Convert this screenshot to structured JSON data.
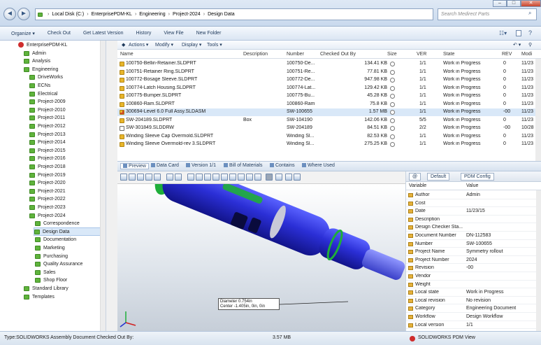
{
  "address": {
    "crumbs": [
      "Local Disk (C:)",
      "EnterprisePDM-KL",
      "Engineering",
      "Project-2024",
      "Design Data"
    ],
    "separator": "›",
    "search_placeholder": "Search Medirect Parts"
  },
  "window_buttons": {
    "minimize": "–",
    "maximize": "□",
    "close": "✕"
  },
  "toolbar": {
    "items": [
      "Organize ▾",
      "Check Out",
      "Get Latest Version",
      "History",
      "View File",
      "New Folder"
    ]
  },
  "tree": {
    "root": "EnterprisePDM-KL",
    "items": [
      {
        "label": "Admin"
      },
      {
        "label": "Analysis"
      },
      {
        "label": "Engineering"
      },
      {
        "label": "DriveWorks"
      },
      {
        "label": "ECNs"
      },
      {
        "label": "Electrical"
      },
      {
        "label": "Project-2009"
      },
      {
        "label": "Project-2010"
      },
      {
        "label": "Project-2011"
      },
      {
        "label": "Project-2012"
      },
      {
        "label": "Project-2013"
      },
      {
        "label": "Project-2014"
      },
      {
        "label": "Project-2015"
      },
      {
        "label": "Project-2016"
      },
      {
        "label": "Project-2018"
      },
      {
        "label": "Project-2019"
      },
      {
        "label": "Project-2020"
      },
      {
        "label": "Project-2021"
      },
      {
        "label": "Project-2022"
      },
      {
        "label": "Project-2023"
      },
      {
        "label": "Project-2024"
      },
      {
        "label": "Correspondence"
      },
      {
        "label": "Design Data"
      },
      {
        "label": "Documentation"
      },
      {
        "label": "Marketing"
      },
      {
        "label": "Purchasing"
      },
      {
        "label": "Quality Assurance"
      },
      {
        "label": "Sales"
      },
      {
        "label": "Shop Floor"
      },
      {
        "label": "Standard Library"
      },
      {
        "label": "Templates"
      }
    ]
  },
  "list_toolbar": [
    "Actions ▾",
    "Modify ▾",
    "Display ▾",
    "Tools ▾"
  ],
  "columns": [
    "Name",
    "Description",
    "Number",
    "Checked Out By",
    "Size",
    "VER",
    "State",
    "REV",
    "Modi"
  ],
  "files": [
    {
      "name": "100750-Bellin-Retainer.SLDPRT",
      "desc": "",
      "number": "100750-De...",
      "size": "134.41 KB",
      "ver": "1/1",
      "state": "Work in Progress",
      "rev": "0",
      "mod": "11/23"
    },
    {
      "name": "100751-Retainer Ring.SLDPRT",
      "desc": "",
      "number": "100751-Re...",
      "size": "77.81 KB",
      "ver": "1/1",
      "state": "Work in Progress",
      "rev": "0",
      "mod": "11/23"
    },
    {
      "name": "100772-Bosage Sleeve.SLDPRT",
      "desc": "",
      "number": "100772-De...",
      "size": "947.98 KB",
      "ver": "1/1",
      "state": "Work in Progress",
      "rev": "0",
      "mod": "11/23"
    },
    {
      "name": "100774-Latch Housing.SLDPRT",
      "desc": "",
      "number": "100774-Lat...",
      "size": "129.42 KB",
      "ver": "1/1",
      "state": "Work in Progress",
      "rev": "0",
      "mod": "11/23"
    },
    {
      "name": "100775-Bumper.SLDPRT",
      "desc": "",
      "number": "100775-Bu...",
      "size": "45.28 KB",
      "ver": "1/1",
      "state": "Work in Progress",
      "rev": "0",
      "mod": "11/23"
    },
    {
      "name": "100860-Ram.SLDPRT",
      "desc": "",
      "number": "100860-Ram",
      "size": "75.8 KB",
      "ver": "1/1",
      "state": "Work in Progress",
      "rev": "0",
      "mod": "11/23"
    },
    {
      "name": "300694-Level 6.0 Full Assy.SLDASM",
      "desc": "",
      "number": "SW-100655",
      "size": "1.57 MB",
      "ver": "1/1",
      "state": "Work in Progress",
      "rev": "-00",
      "mod": "11/23"
    },
    {
      "name": "SW-204189.SLDPRT",
      "desc": "Box",
      "number": "SW-104190",
      "size": "142.06 KB",
      "ver": "5/5",
      "state": "Work in Progress",
      "rev": "0",
      "mod": "11/23"
    },
    {
      "name": "SW-301849.SLDDRW",
      "desc": "",
      "number": "SW-204189",
      "size": "84.51 KB",
      "ver": "2/2",
      "state": "Work in Progress",
      "rev": "-00",
      "mod": "10/28"
    },
    {
      "name": "Winding Sleeve Cap Overmold.SLDPRT",
      "desc": "",
      "number": "Winding Sl...",
      "size": "82.53 KB",
      "ver": "1/1",
      "state": "Work in Progress",
      "rev": "0",
      "mod": "11/23"
    },
    {
      "name": "Winding Sleeve Overmold-rev 3.SLDPRT",
      "desc": "",
      "number": "Winding Sl...",
      "size": "275.25 KB",
      "ver": "1/1",
      "state": "Work in Progress",
      "rev": "0",
      "mod": "11/23"
    }
  ],
  "tabs": [
    "Preview",
    "Data Card",
    "Version 1/1",
    "Bill of Materials",
    "Contains",
    "Where Used"
  ],
  "callout": {
    "line1": "Diameter  0.754in",
    "line2": "Center  -1.405in, 0in, 0in"
  },
  "props": {
    "tabs": [
      "@",
      "Default",
      "PDM Config"
    ],
    "headers": [
      "Variable",
      "Value"
    ],
    "rows": [
      {
        "k": "Author",
        "v": "Admin"
      },
      {
        "k": "Cost",
        "v": ""
      },
      {
        "k": "Date",
        "v": "11/23/15"
      },
      {
        "k": "Description",
        "v": ""
      },
      {
        "k": "Design Checker Sta...",
        "v": ""
      },
      {
        "k": "Document Number",
        "v": "DN-112583"
      },
      {
        "k": "Number",
        "v": "SW-100655"
      },
      {
        "k": "Project Name",
        "v": "Symmetry rollout"
      },
      {
        "k": "Project Number",
        "v": "2024"
      },
      {
        "k": "Revision",
        "v": "-00"
      },
      {
        "k": "Vendor",
        "v": ""
      },
      {
        "k": "Weight",
        "v": ""
      },
      {
        "k": "Local state",
        "v": "Work in Progress"
      },
      {
        "k": "Local revision",
        "v": "No revision"
      },
      {
        "k": "Category",
        "v": "Engineering Document"
      },
      {
        "k": "Workflow",
        "v": "Design Workflow"
      },
      {
        "k": "Local version",
        "v": "1/1"
      }
    ]
  },
  "status": {
    "left": "Type:SOLIDWORKS Assembly Document  Checked Out By:",
    "size": "3.57 MB",
    "app": "SOLIDWORKS PDM View"
  },
  "colors": {
    "accent": "#1e395b",
    "folder": "#5fb33c",
    "model_body": "#2b2fd6",
    "model_accent": "#1fae3a"
  }
}
